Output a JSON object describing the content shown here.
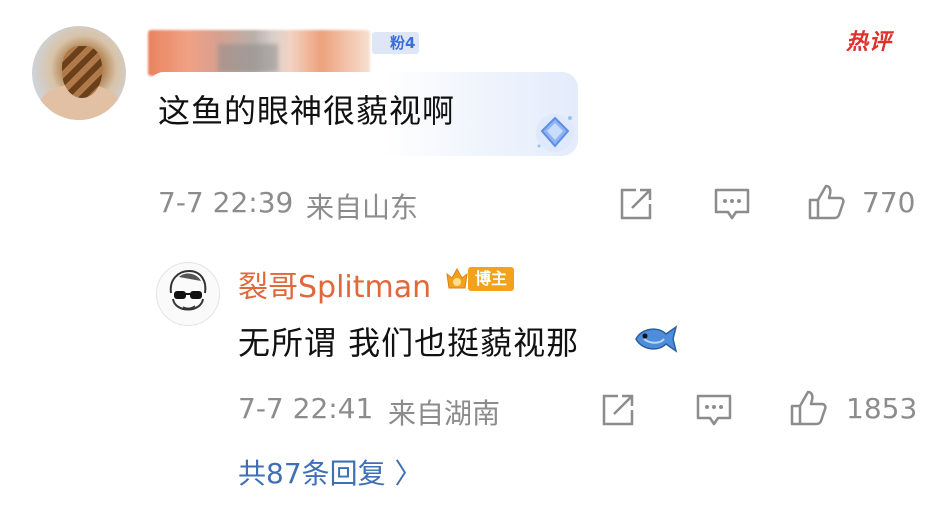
{
  "comment": {
    "fan_badge": "粉4",
    "hot_label": "热评",
    "text": "这鱼的眼神很藐视啊",
    "time": "7-7 22:39",
    "location": "来自山东",
    "like_count": "770"
  },
  "reply": {
    "username": "裂哥Splitman",
    "badge": "博主",
    "text": "无所谓 我们也挺藐视那",
    "time": "7-7 22:41",
    "location": "来自湖南",
    "like_count": "1853"
  },
  "more_replies": "共87条回复 〉",
  "colors": {
    "hot_red": "#e0302c",
    "username_orange": "#e0683a",
    "link_blue": "#3f6fb5",
    "meta_gray": "#8c8c8c"
  }
}
